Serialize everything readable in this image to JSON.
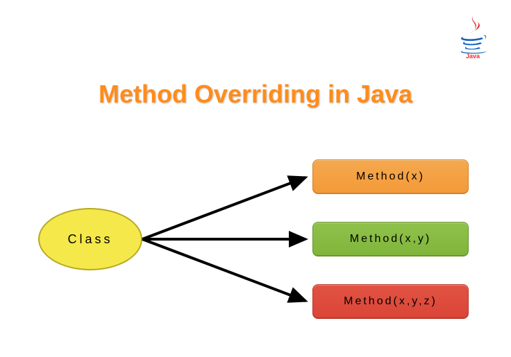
{
  "logo": {
    "name": "Java"
  },
  "title": "Method Overriding in Java",
  "class_node": {
    "label": "Class"
  },
  "methods": [
    {
      "label": "Method(x)",
      "color": "#f39a38"
    },
    {
      "label": "Method(x,y)",
      "color": "#7fb53a"
    },
    {
      "label": "Method(x,y,z)",
      "color": "#db4536"
    }
  ]
}
